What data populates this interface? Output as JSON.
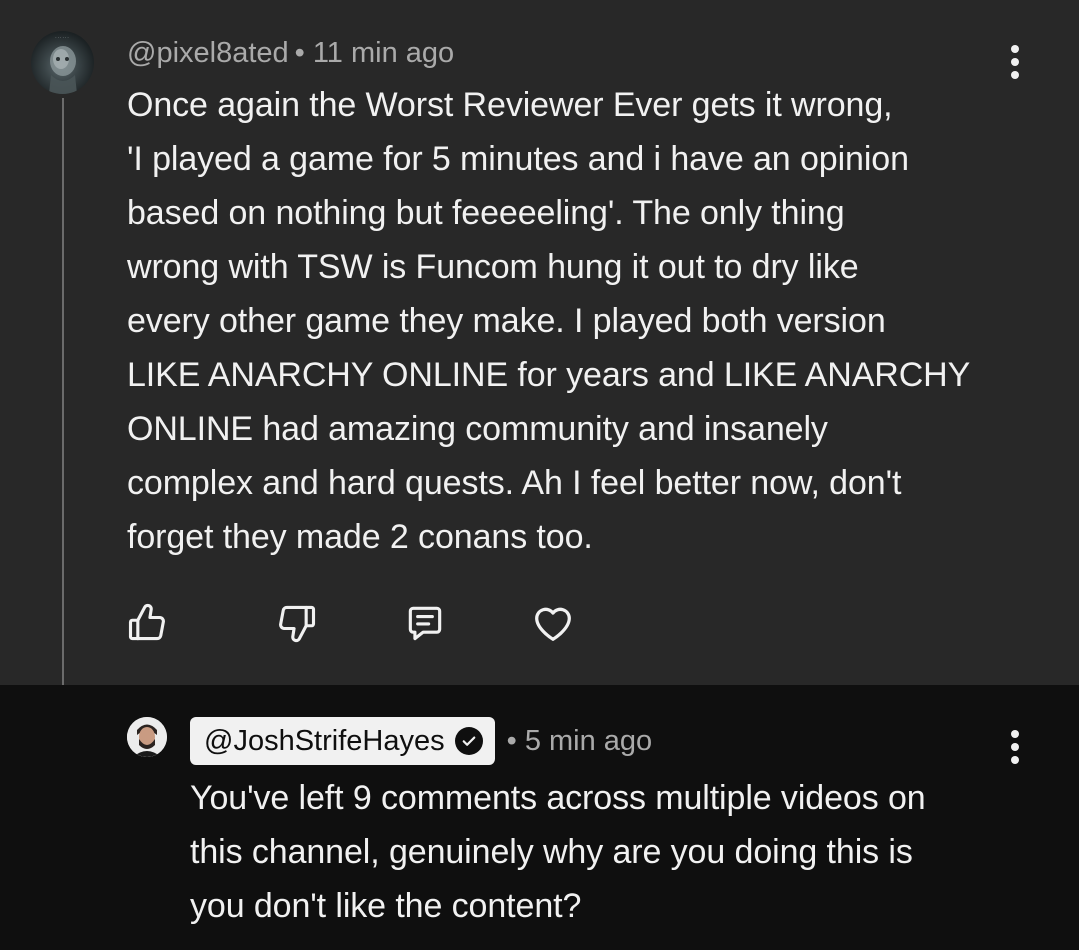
{
  "parent_comment": {
    "author": "@pixel8ated",
    "separator": "•",
    "time": "11 min ago",
    "text": "Once again the Worst Reviewer Ever gets it wrong,\n'I played a game for 5 minutes and i have an opinion\nbased on nothing  but feeeeeling'. The only thing\nwrong with TSW is Funcom hung it out to dry like\nevery other game they make. I played both version\nLIKE ANARCHY ONLINE for years and LIKE ANARCHY\nONLINE had amazing community and insanely\ncomplex  and hard quests. Ah I feel better now, don't\nforget they made 2 conans too.",
    "actions": [
      {
        "name": "like",
        "icon": "thumbs-up-icon"
      },
      {
        "name": "dislike",
        "icon": "thumbs-down-icon"
      },
      {
        "name": "reply",
        "icon": "reply-icon"
      },
      {
        "name": "heart",
        "icon": "heart-icon"
      }
    ],
    "menu_icon": "more-vertical-icon"
  },
  "reply_comment": {
    "author": "@JoshStrifeHayes",
    "verified": true,
    "separator": "•",
    "time": "5 min ago",
    "text": "You've left 9 comments across multiple videos on\nthis channel, genuinely why are you doing this is\nyou don't like the content?",
    "menu_icon": "more-vertical-icon"
  },
  "colors": {
    "parent_bg": "#282828",
    "reply_bg": "#0f0f0f",
    "text_primary": "#f1f1f1",
    "text_secondary": "#aaaaaa",
    "thread_line": "#6b6b6b",
    "author_pill_bg": "#f1f1f1"
  }
}
